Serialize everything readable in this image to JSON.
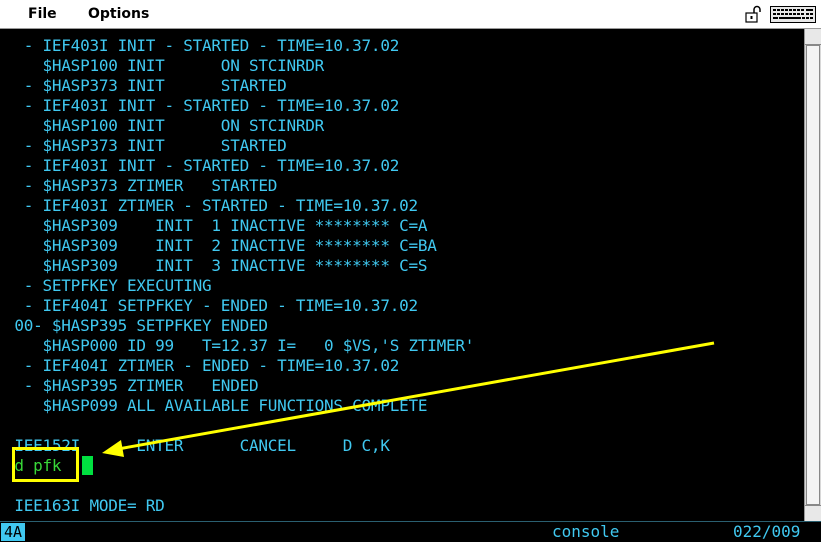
{
  "menu": {
    "file": "File",
    "options": "Options"
  },
  "icons": {
    "lock": "lock-icon",
    "keyboard": "keyboard-icon"
  },
  "colors": {
    "text": "#40c8f0",
    "input_text": "#38d838",
    "cursor": "#00e040",
    "highlight": "#ffff00",
    "background": "#000000"
  },
  "terminal": {
    "lines": [
      "  - IEF403I INIT - STARTED - TIME=10.37.02",
      "    $HASP100 INIT      ON STCINRDR",
      "  - $HASP373 INIT      STARTED",
      "  - IEF403I INIT - STARTED - TIME=10.37.02",
      "    $HASP100 INIT      ON STCINRDR",
      "  - $HASP373 INIT      STARTED",
      "  - IEF403I INIT - STARTED - TIME=10.37.02",
      "  - $HASP373 ZTIMER   STARTED",
      "  - IEF403I ZTIMER - STARTED - TIME=10.37.02",
      "    $HASP309    INIT  1 INACTIVE ******** C=A",
      "    $HASP309    INIT  2 INACTIVE ******** C=BA",
      "    $HASP309    INIT  3 INACTIVE ******** C=S",
      "  - SETPFKEY EXECUTING",
      "  - IEF404I SETPFKEY - ENDED - TIME=10.37.02",
      " 00- $HASP395 SETPFKEY ENDED",
      "    $HASP000 ID 99   T=12.37 I=   0 $VS,'S ZTIMER'",
      "  - IEF404I ZTIMER - ENDED - TIME=10.37.02",
      "  - $HASP395 ZTIMER   ENDED",
      "    $HASP099 ALL AVAILABLE FUNCTIONS COMPLETE"
    ],
    "prompt_line": " IEE152I      ENTER      CANCEL     D C,K",
    "input_text": " d pfk",
    "mode_line": " IEE163I MODE= RD"
  },
  "status": {
    "oia": "4A",
    "session": "console",
    "cursor_pos": "022/009"
  }
}
